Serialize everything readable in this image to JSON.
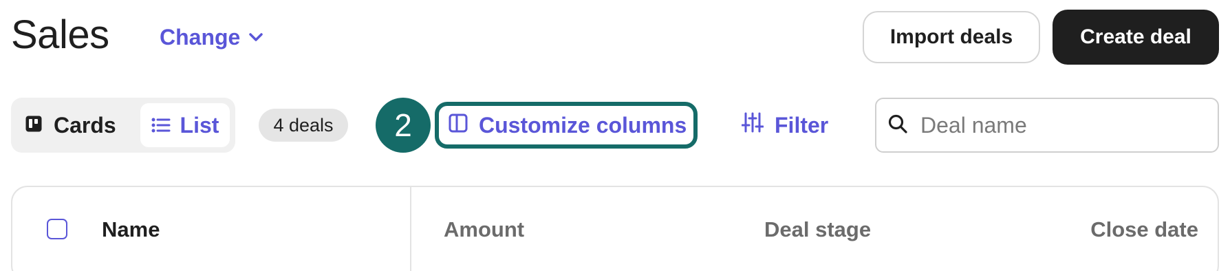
{
  "header": {
    "title": "Sales",
    "change_label": "Change",
    "import_label": "Import deals",
    "create_label": "Create deal"
  },
  "toolbar": {
    "view_cards_label": "Cards",
    "view_list_label": "List",
    "active_view": "List",
    "deal_count": "4 deals",
    "step_number": "2",
    "customize_label": "Customize columns",
    "filter_label": "Filter",
    "search": {
      "placeholder": "Deal name",
      "value": ""
    }
  },
  "table": {
    "columns": [
      "Name",
      "Amount",
      "Deal stage",
      "Close date"
    ],
    "select_all_checked": false
  },
  "icons": {
    "change": "chevron-down-icon",
    "cards": "kanban-board-icon",
    "list": "list-icon",
    "customize": "columns-icon",
    "filter": "sliders-icon",
    "search": "search-icon"
  },
  "colors": {
    "accent": "#5a56d8",
    "highlight": "#156b68",
    "primary_button": "#1f1f1f",
    "muted_text": "#6b6b6b"
  }
}
